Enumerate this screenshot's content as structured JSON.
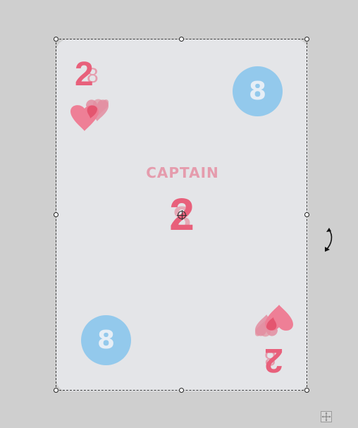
{
  "card": {
    "title": "CAPTAIN",
    "rank_primary": "2",
    "rank_secondary": "8",
    "circle_value_top": "8",
    "circle_value_bottom": "8"
  },
  "colors": {
    "card_bg": "#e4e5e8",
    "accent_pink": "#e8607b",
    "accent_blue": "#93c9ec",
    "canvas_bg": "#cfcfcf"
  },
  "icons": {
    "suit": "heart-icon",
    "rotate": "rotate-icon",
    "move": "move-icon",
    "center": "crosshair-icon"
  }
}
